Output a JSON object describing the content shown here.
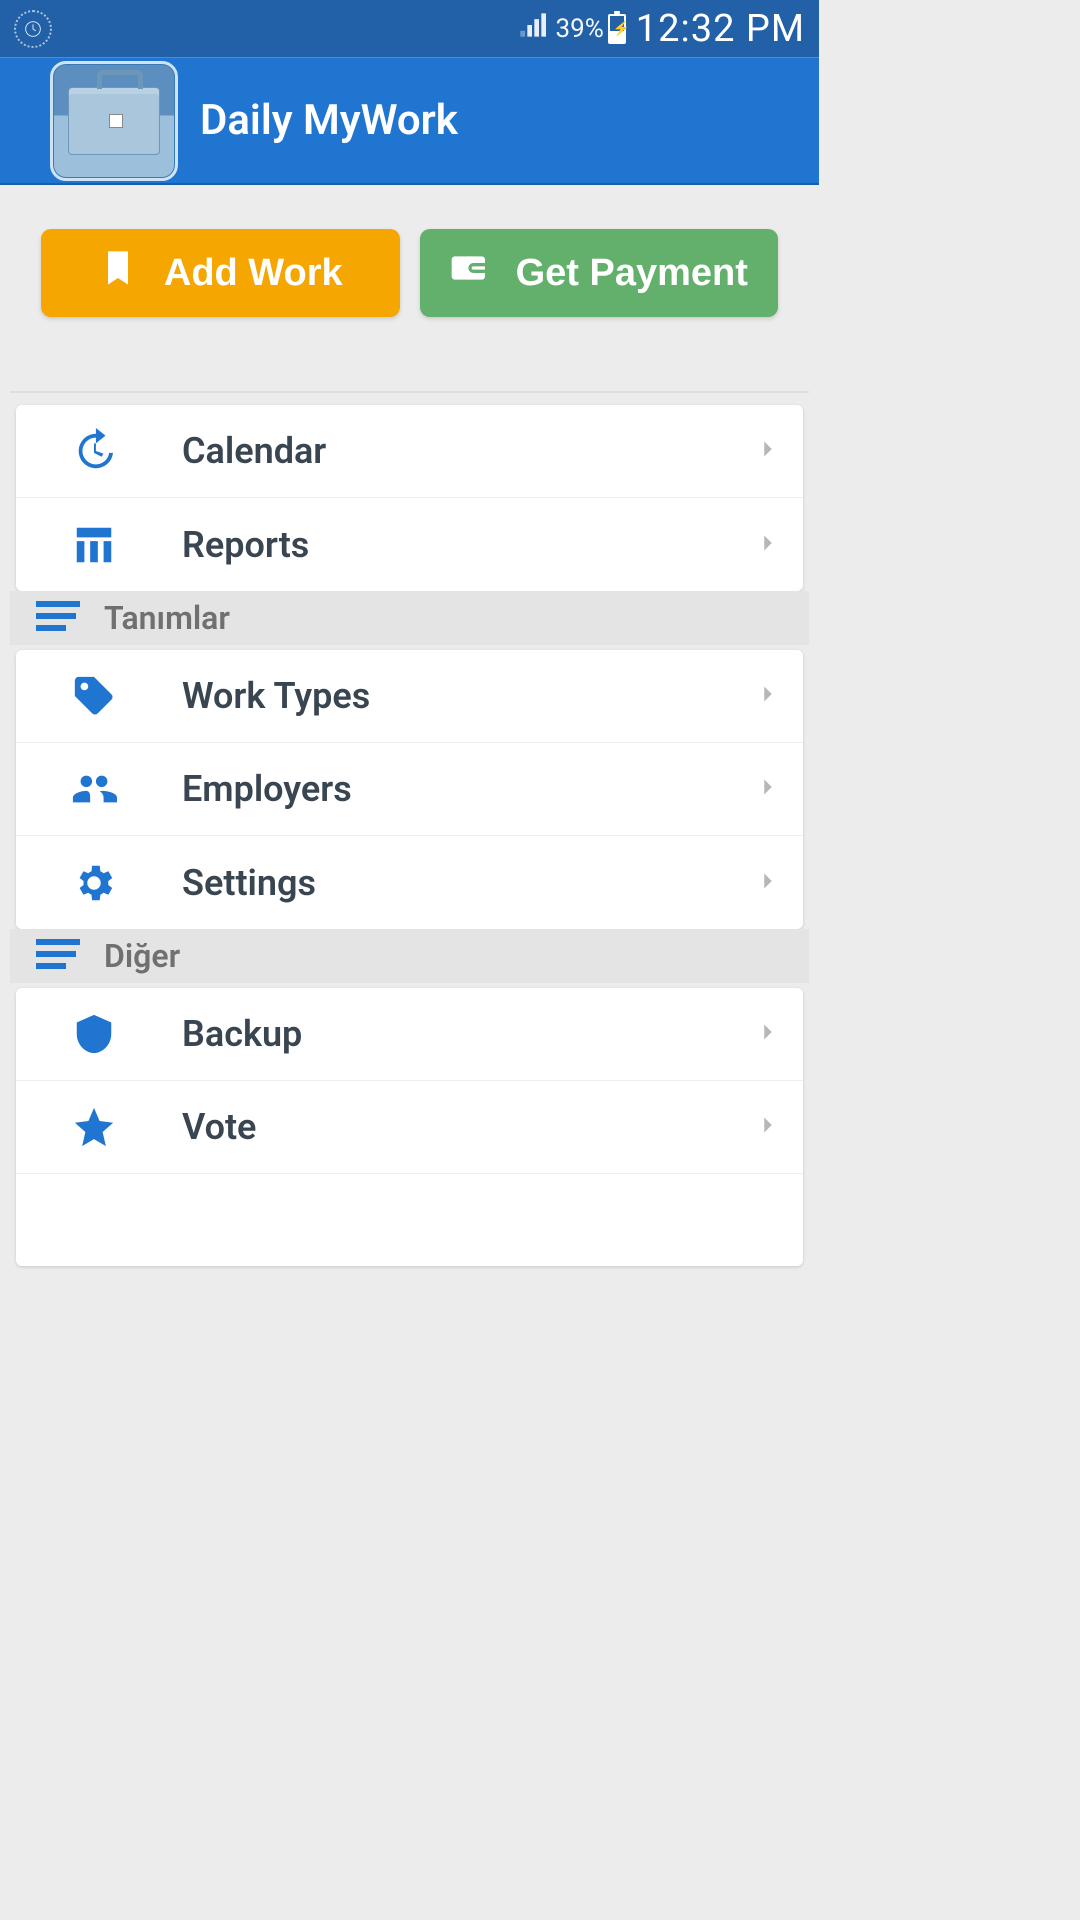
{
  "status_bar": {
    "battery_pct": "39%",
    "time": "12:32 PM"
  },
  "header": {
    "title": "Daily MyWork"
  },
  "actions": {
    "add_work_label": "Add Work",
    "get_payment_label": "Get Payment"
  },
  "menu": {
    "group0": {
      "items": [
        {
          "label": "Calendar",
          "icon": "history"
        },
        {
          "label": "Reports",
          "icon": "column-chart"
        }
      ]
    },
    "group1": {
      "title": "Tanımlar",
      "items": [
        {
          "label": "Work Types",
          "icon": "tag"
        },
        {
          "label": "Employers",
          "icon": "people"
        },
        {
          "label": "Settings",
          "icon": "gear"
        }
      ]
    },
    "group2": {
      "title": "Diğer",
      "items": [
        {
          "label": "Backup",
          "icon": "shield"
        },
        {
          "label": "Vote",
          "icon": "star"
        }
      ]
    }
  },
  "colors": {
    "primary": "#1f75d0",
    "status_bar": "#2261a8",
    "orange": "#f6a600",
    "green": "#62b06b"
  }
}
